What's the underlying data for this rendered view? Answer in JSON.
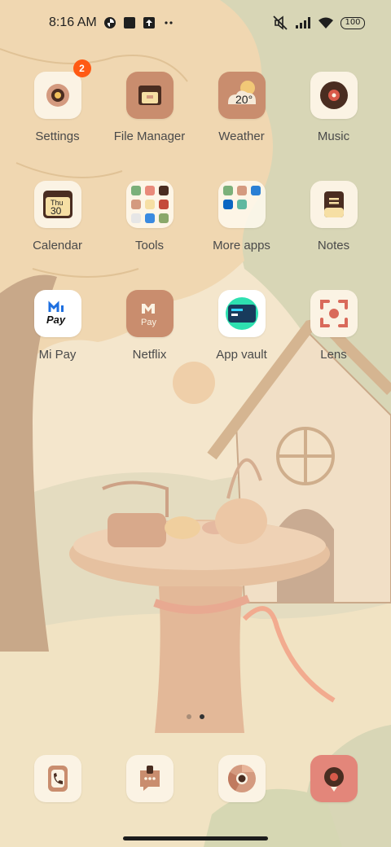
{
  "status_bar": {
    "time": "8:16 AM",
    "battery": "100",
    "left_icons": [
      "sync-icon",
      "square-notification-icon",
      "upload-icon",
      "more-dots-icon"
    ],
    "right_icons": [
      "mute-icon",
      "signal-icon",
      "wifi-icon",
      "battery-icon"
    ]
  },
  "apps": [
    {
      "label": "Settings",
      "icon": "settings-icon",
      "badge": "2"
    },
    {
      "label": "File Manager",
      "icon": "file-manager-icon"
    },
    {
      "label": "Weather",
      "icon": "weather-icon",
      "temp": "20°"
    },
    {
      "label": "Music",
      "icon": "music-icon"
    },
    {
      "label": "Calendar",
      "icon": "calendar-icon",
      "day": "Thu",
      "date": "30"
    },
    {
      "label": "Tools",
      "icon": "folder-icon"
    },
    {
      "label": "More apps",
      "icon": "folder-icon"
    },
    {
      "label": "Notes",
      "icon": "notes-icon"
    },
    {
      "label": "Mi Pay",
      "icon": "mi-pay-icon",
      "text": "Pay"
    },
    {
      "label": "Netflix",
      "icon": "netflix-icon",
      "text": "Pay"
    },
    {
      "label": "App vault",
      "icon": "app-vault-icon"
    },
    {
      "label": "Lens",
      "icon": "lens-icon"
    }
  ],
  "page_indicator": {
    "count": 2,
    "active": 2
  },
  "dock": [
    {
      "icon": "phone-icon"
    },
    {
      "icon": "messages-icon"
    },
    {
      "icon": "chrome-icon"
    },
    {
      "icon": "camera-icon"
    }
  ],
  "colors": {
    "badge": "#ff5a14",
    "icon_brown": "#c98d6e",
    "icon_cream": "#fbf3e4"
  }
}
